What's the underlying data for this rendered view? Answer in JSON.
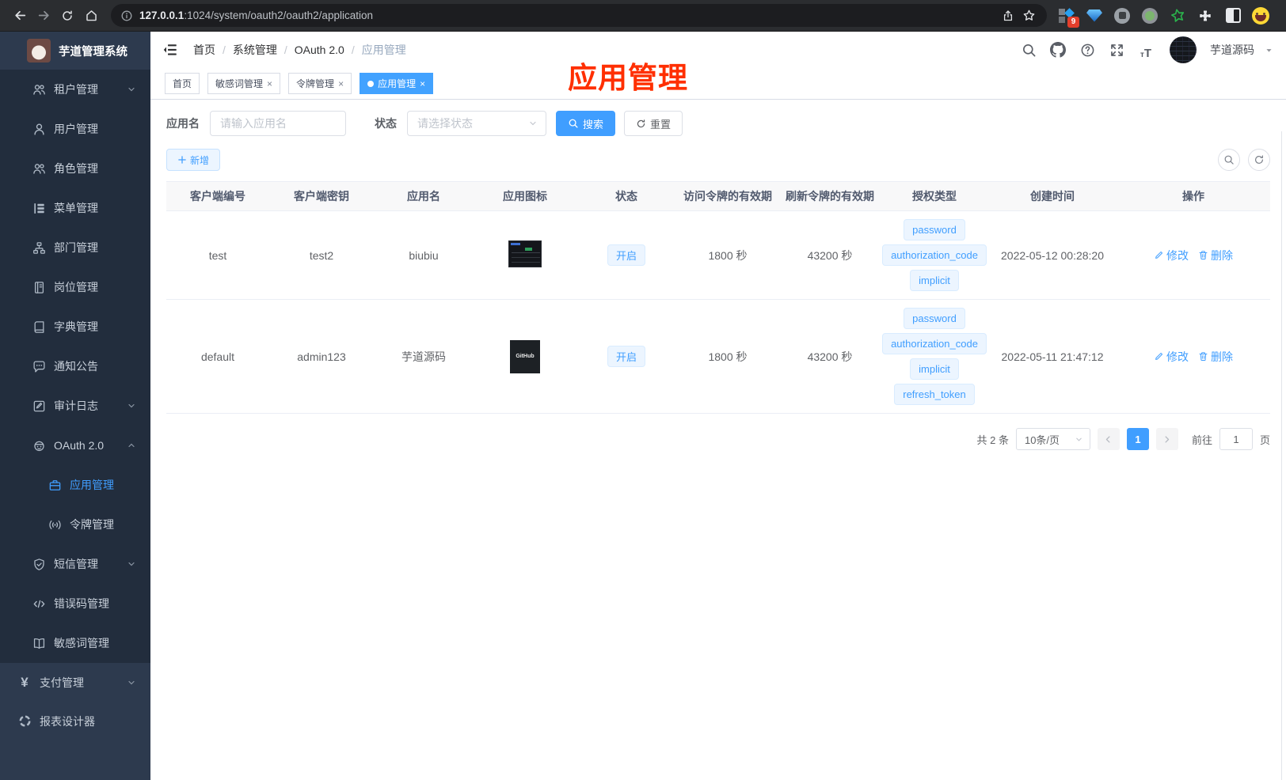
{
  "colors": {
    "accent": "#409eff",
    "overlay_red": "#ff2f00",
    "tag_bg": "#ecf5ff",
    "sidebar_bg": "#222d3d"
  },
  "browser": {
    "url_host": "127.0.0.1",
    "url_path": ":1024/system/oauth2/oauth2/application",
    "extension_badge": "9"
  },
  "sidebar": {
    "title": "芋道管理系统",
    "items": [
      {
        "label": "租户管理"
      },
      {
        "label": "用户管理"
      },
      {
        "label": "角色管理"
      },
      {
        "label": "菜单管理"
      },
      {
        "label": "部门管理"
      },
      {
        "label": "岗位管理"
      },
      {
        "label": "字典管理"
      },
      {
        "label": "通知公告"
      },
      {
        "label": "审计日志"
      },
      {
        "label": "OAuth 2.0"
      },
      {
        "label": "应用管理"
      },
      {
        "label": "令牌管理"
      },
      {
        "label": "短信管理"
      },
      {
        "label": "错误码管理"
      },
      {
        "label": "敏感词管理"
      },
      {
        "label": "支付管理"
      },
      {
        "label": "报表设计器"
      }
    ]
  },
  "header": {
    "breadcrumb": [
      "首页",
      "系统管理",
      "OAuth 2.0",
      "应用管理"
    ],
    "username": "芋道源码"
  },
  "tabs": [
    {
      "label": "首页"
    },
    {
      "label": "敏感词管理"
    },
    {
      "label": "令牌管理"
    },
    {
      "label": "应用管理"
    }
  ],
  "overlay_title": "应用管理",
  "filters": {
    "name_label": "应用名",
    "name_placeholder": "请输入应用名",
    "status_label": "状态",
    "status_placeholder": "请选择状态",
    "search_label": "搜索",
    "reset_label": "重置"
  },
  "toolbar": {
    "add_label": "新增"
  },
  "table": {
    "columns": [
      "客户端编号",
      "客户端密钥",
      "应用名",
      "应用图标",
      "状态",
      "访问令牌的有效期",
      "刷新令牌的有效期",
      "授权类型",
      "创建时间",
      "操作"
    ],
    "edit_label": "修改",
    "delete_label": "删除",
    "rows": [
      {
        "client_id": "test",
        "secret": "test2",
        "name": "biubiu",
        "status": "开启",
        "access_ttl": "1800 秒",
        "refresh_ttl": "43200 秒",
        "grants": [
          "password",
          "authorization_code",
          "implicit"
        ],
        "created": "2022-05-12 00:28:20"
      },
      {
        "client_id": "default",
        "secret": "admin123",
        "name": "芋道源码",
        "icon_label": "GitHub",
        "status": "开启",
        "access_ttl": "1800 秒",
        "refresh_ttl": "43200 秒",
        "grants": [
          "password",
          "authorization_code",
          "implicit",
          "refresh_token"
        ],
        "created": "2022-05-11 21:47:12"
      }
    ]
  },
  "pagination": {
    "total": "共 2 条",
    "page_size": "10条/页",
    "current_page": "1",
    "goto_label": "前往",
    "goto_value": "1",
    "page_suffix": "页"
  }
}
